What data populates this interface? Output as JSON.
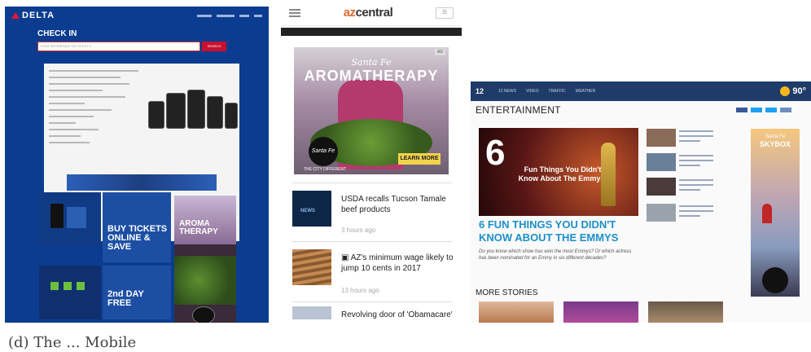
{
  "delta": {
    "logo_text": "DELTA",
    "checkin_title": "CHECK IN",
    "search_placeholder": "YOUR REFERENCE OR TICKET #",
    "search_button": "SEARCH",
    "banner_text": "",
    "tile_buy": "BUY TICKETS ONLINE & SAVE",
    "tile_day": "2nd DAY FREE",
    "aroma_text": "AROMA THERAPY"
  },
  "az": {
    "brand_prefix": "az",
    "brand_suffix": "central",
    "ad_badge": "AD",
    "ad_script": "Santa Fe",
    "ad_title": "AROMATHERAPY",
    "ad_logo": "Santa Fe",
    "ad_sub": "THE CITY DIFFERENT",
    "ad_cta": "LEARN MORE",
    "items": [
      {
        "title": "USDA recalls Tucson Tamale beef products",
        "time": "3 hours ago",
        "thumb_label": "NEWS"
      },
      {
        "title": "AZ's minimum wage likely to jump 10 cents in 2017",
        "time": "13 hours ago",
        "thumb_label": ""
      },
      {
        "title": "Revolving door of 'Obamacare'",
        "time": "",
        "thumb_label": ""
      }
    ]
  },
  "news12": {
    "logo": "12",
    "nav_links": [
      "12 NEWS",
      "VIDEO",
      "TRAFFIC",
      "WEATHER"
    ],
    "temperature": "90°",
    "section_title": "ENTERTAINMENT",
    "hero_number": "6",
    "hero_caption": "Fun Things You Didn't Know About The Emmys!",
    "headline": "6 FUN THINGS YOU DIDN'T KNOW ABOUT THE EMMYS",
    "dek": "Do you know which show has won the most Emmys? Or which actress has been nominated for an Emmy in six different decades?",
    "more_stories": "MORE STORIES",
    "skybox_top": "Santa Fe",
    "skybox_main": "SKYBOX"
  },
  "caption": "(d) The ... Mobile"
}
